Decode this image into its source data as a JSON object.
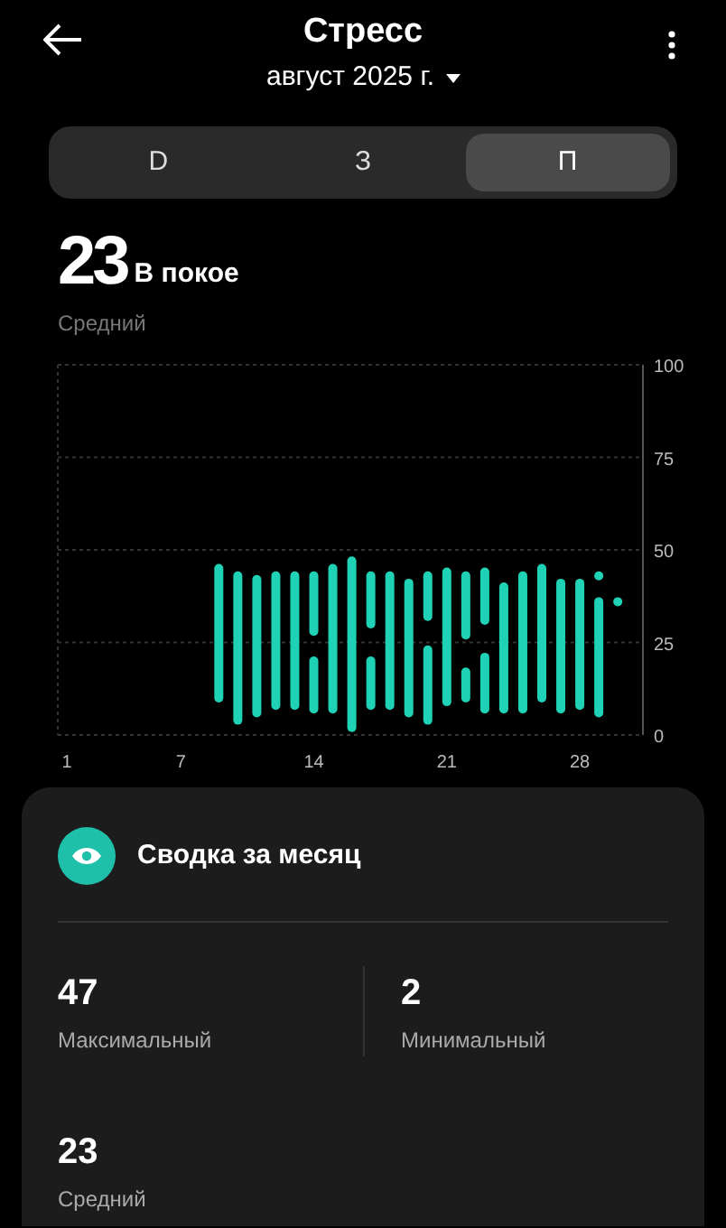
{
  "header": {
    "title": "Стресс",
    "subtitle": "август 2025 г."
  },
  "tabs": [
    {
      "label": "D",
      "selected": false
    },
    {
      "label": "З",
      "selected": false
    },
    {
      "label": "П",
      "selected": true
    }
  ],
  "summary": {
    "value": "23",
    "label": "В покое",
    "caption": "Средний"
  },
  "chart": {
    "y_labels": [
      "100",
      "75",
      "50",
      "25",
      "0"
    ],
    "x_labels": [
      "1",
      "7",
      "14",
      "21",
      "28"
    ]
  },
  "card": {
    "title": "Сводка за месяц",
    "stats": [
      {
        "value": "47",
        "label": "Максимальный"
      },
      {
        "value": "2",
        "label": "Минимальный"
      },
      {
        "value": "23",
        "label": "Средний"
      }
    ]
  }
}
